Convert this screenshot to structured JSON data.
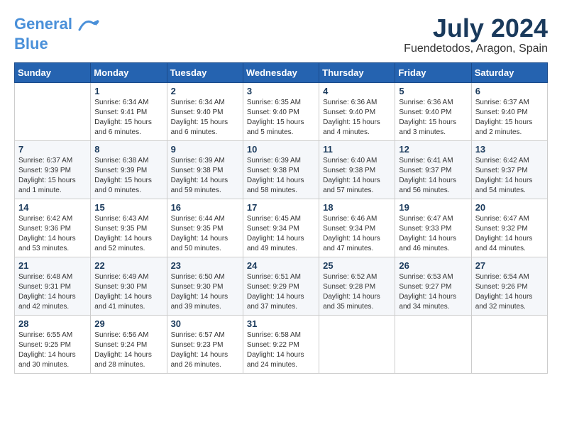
{
  "header": {
    "logo_line1": "General",
    "logo_line2": "Blue",
    "month_year": "July 2024",
    "location": "Fuendetodos, Aragon, Spain"
  },
  "weekdays": [
    "Sunday",
    "Monday",
    "Tuesday",
    "Wednesday",
    "Thursday",
    "Friday",
    "Saturday"
  ],
  "weeks": [
    [
      {
        "day": "",
        "info": ""
      },
      {
        "day": "1",
        "info": "Sunrise: 6:34 AM\nSunset: 9:41 PM\nDaylight: 15 hours\nand 6 minutes."
      },
      {
        "day": "2",
        "info": "Sunrise: 6:34 AM\nSunset: 9:40 PM\nDaylight: 15 hours\nand 6 minutes."
      },
      {
        "day": "3",
        "info": "Sunrise: 6:35 AM\nSunset: 9:40 PM\nDaylight: 15 hours\nand 5 minutes."
      },
      {
        "day": "4",
        "info": "Sunrise: 6:36 AM\nSunset: 9:40 PM\nDaylight: 15 hours\nand 4 minutes."
      },
      {
        "day": "5",
        "info": "Sunrise: 6:36 AM\nSunset: 9:40 PM\nDaylight: 15 hours\nand 3 minutes."
      },
      {
        "day": "6",
        "info": "Sunrise: 6:37 AM\nSunset: 9:40 PM\nDaylight: 15 hours\nand 2 minutes."
      }
    ],
    [
      {
        "day": "7",
        "info": "Sunrise: 6:37 AM\nSunset: 9:39 PM\nDaylight: 15 hours\nand 1 minute."
      },
      {
        "day": "8",
        "info": "Sunrise: 6:38 AM\nSunset: 9:39 PM\nDaylight: 15 hours\nand 0 minutes."
      },
      {
        "day": "9",
        "info": "Sunrise: 6:39 AM\nSunset: 9:38 PM\nDaylight: 14 hours\nand 59 minutes."
      },
      {
        "day": "10",
        "info": "Sunrise: 6:39 AM\nSunset: 9:38 PM\nDaylight: 14 hours\nand 58 minutes."
      },
      {
        "day": "11",
        "info": "Sunrise: 6:40 AM\nSunset: 9:38 PM\nDaylight: 14 hours\nand 57 minutes."
      },
      {
        "day": "12",
        "info": "Sunrise: 6:41 AM\nSunset: 9:37 PM\nDaylight: 14 hours\nand 56 minutes."
      },
      {
        "day": "13",
        "info": "Sunrise: 6:42 AM\nSunset: 9:37 PM\nDaylight: 14 hours\nand 54 minutes."
      }
    ],
    [
      {
        "day": "14",
        "info": "Sunrise: 6:42 AM\nSunset: 9:36 PM\nDaylight: 14 hours\nand 53 minutes."
      },
      {
        "day": "15",
        "info": "Sunrise: 6:43 AM\nSunset: 9:35 PM\nDaylight: 14 hours\nand 52 minutes."
      },
      {
        "day": "16",
        "info": "Sunrise: 6:44 AM\nSunset: 9:35 PM\nDaylight: 14 hours\nand 50 minutes."
      },
      {
        "day": "17",
        "info": "Sunrise: 6:45 AM\nSunset: 9:34 PM\nDaylight: 14 hours\nand 49 minutes."
      },
      {
        "day": "18",
        "info": "Sunrise: 6:46 AM\nSunset: 9:34 PM\nDaylight: 14 hours\nand 47 minutes."
      },
      {
        "day": "19",
        "info": "Sunrise: 6:47 AM\nSunset: 9:33 PM\nDaylight: 14 hours\nand 46 minutes."
      },
      {
        "day": "20",
        "info": "Sunrise: 6:47 AM\nSunset: 9:32 PM\nDaylight: 14 hours\nand 44 minutes."
      }
    ],
    [
      {
        "day": "21",
        "info": "Sunrise: 6:48 AM\nSunset: 9:31 PM\nDaylight: 14 hours\nand 42 minutes."
      },
      {
        "day": "22",
        "info": "Sunrise: 6:49 AM\nSunset: 9:30 PM\nDaylight: 14 hours\nand 41 minutes."
      },
      {
        "day": "23",
        "info": "Sunrise: 6:50 AM\nSunset: 9:30 PM\nDaylight: 14 hours\nand 39 minutes."
      },
      {
        "day": "24",
        "info": "Sunrise: 6:51 AM\nSunset: 9:29 PM\nDaylight: 14 hours\nand 37 minutes."
      },
      {
        "day": "25",
        "info": "Sunrise: 6:52 AM\nSunset: 9:28 PM\nDaylight: 14 hours\nand 35 minutes."
      },
      {
        "day": "26",
        "info": "Sunrise: 6:53 AM\nSunset: 9:27 PM\nDaylight: 14 hours\nand 34 minutes."
      },
      {
        "day": "27",
        "info": "Sunrise: 6:54 AM\nSunset: 9:26 PM\nDaylight: 14 hours\nand 32 minutes."
      }
    ],
    [
      {
        "day": "28",
        "info": "Sunrise: 6:55 AM\nSunset: 9:25 PM\nDaylight: 14 hours\nand 30 minutes."
      },
      {
        "day": "29",
        "info": "Sunrise: 6:56 AM\nSunset: 9:24 PM\nDaylight: 14 hours\nand 28 minutes."
      },
      {
        "day": "30",
        "info": "Sunrise: 6:57 AM\nSunset: 9:23 PM\nDaylight: 14 hours\nand 26 minutes."
      },
      {
        "day": "31",
        "info": "Sunrise: 6:58 AM\nSunset: 9:22 PM\nDaylight: 14 hours\nand 24 minutes."
      },
      {
        "day": "",
        "info": ""
      },
      {
        "day": "",
        "info": ""
      },
      {
        "day": "",
        "info": ""
      }
    ]
  ]
}
